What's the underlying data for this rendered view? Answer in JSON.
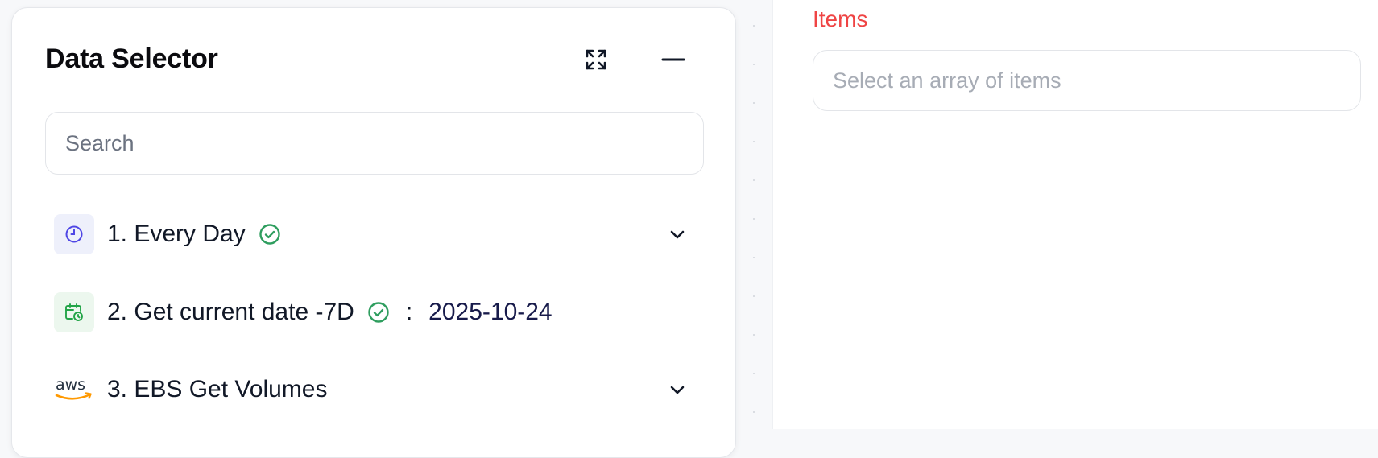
{
  "data_selector": {
    "title": "Data Selector",
    "expand_icon": "expand-arrows-icon",
    "minimize_icon": "minus-icon",
    "search": {
      "placeholder": "Search",
      "value": ""
    },
    "steps": [
      {
        "label": "1. Every Day",
        "icon": "clock-icon",
        "status": "check-circle-icon",
        "expandable": true
      },
      {
        "label": "2. Get current date -7D",
        "icon": "calendar-clock-icon",
        "status": "check-circle-icon",
        "separator": ":",
        "value": "2025-10-24",
        "expandable": false
      },
      {
        "label": "3. EBS Get Volumes",
        "icon": "aws-logo-icon",
        "logo_text": "aws",
        "expandable": true
      }
    ]
  },
  "items_field": {
    "label": "Items",
    "placeholder": "Select an array of items",
    "value": ""
  },
  "colors": {
    "items_label": "#ef4444",
    "check_green": "#2f9e5f",
    "clock_purple": "#4f46e5",
    "calendar_green": "#22a447",
    "aws_orange": "#ff9900",
    "value_navy": "#171a4a"
  }
}
